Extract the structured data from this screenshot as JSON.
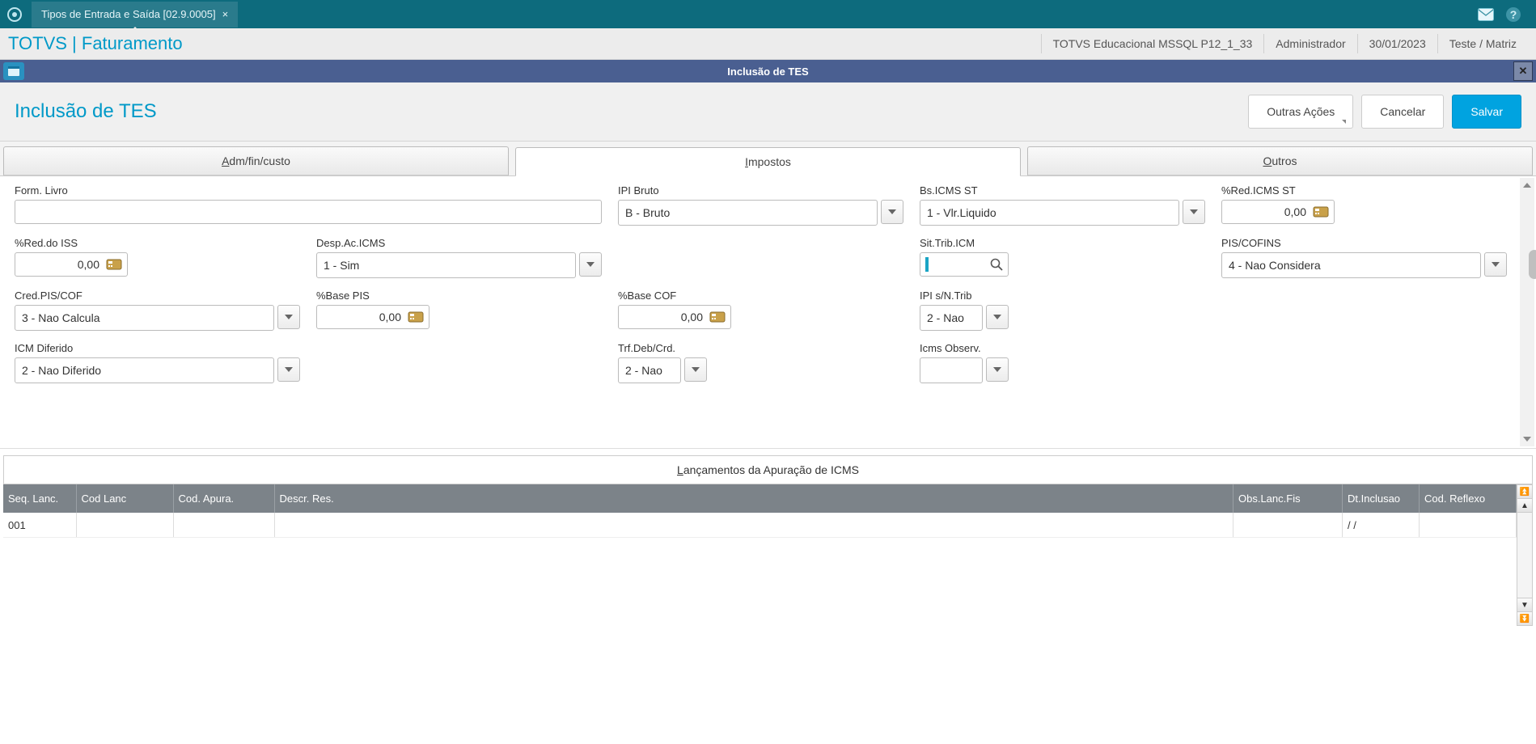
{
  "topbar": {
    "tab_title": "Tipos de Entrada e Saída [02.9.0005]"
  },
  "infobar": {
    "module": "TOTVS | Faturamento",
    "env": "TOTVS Educacional MSSQL P12_1_33",
    "user": "Administrador",
    "date": "30/01/2023",
    "branch": "Teste / Matriz"
  },
  "winbar": {
    "title": "Inclusão de TES"
  },
  "actionbar": {
    "page_title": "Inclusão de TES",
    "other_actions": "Outras Ações",
    "cancel": "Cancelar",
    "save": "Salvar"
  },
  "tabs": {
    "t1_pre": "A",
    "t1_rest": "dm/fin/custo",
    "t2_pre": "I",
    "t2_rest": "mpostos",
    "t3_pre": "O",
    "t3_rest": "utros"
  },
  "fields": {
    "form_livro": {
      "label": "Form. Livro",
      "value": ""
    },
    "ipi_bruto": {
      "label": "IPI Bruto",
      "value": "B - Bruto"
    },
    "bs_icms_st": {
      "label": "Bs.ICMS ST",
      "value": "1 - Vlr.Liquido"
    },
    "pred_icms_st": {
      "label": "%Red.ICMS ST",
      "value": "0,00"
    },
    "pred_iss": {
      "label": "%Red.do ISS",
      "value": "0,00"
    },
    "desp_ac_icms": {
      "label": "Desp.Ac.ICMS",
      "value": "1 - Sim"
    },
    "sit_trib_icm": {
      "label": "Sit.Trib.ICM",
      "value": ""
    },
    "pis_cofins": {
      "label": "PIS/COFINS",
      "value": "4 - Nao Considera"
    },
    "cred_pis_cof": {
      "label": "Cred.PIS/COF",
      "value": "3 - Nao Calcula"
    },
    "pbase_pis": {
      "label": "%Base PIS",
      "value": "0,00"
    },
    "pbase_cof": {
      "label": "%Base COF",
      "value": "0,00"
    },
    "ipi_sntrib": {
      "label": "IPI s/N.Trib",
      "value": "2 - Nao"
    },
    "icm_diferido": {
      "label": "ICM Diferido",
      "value": "2 - Nao Diferido"
    },
    "trf_deb_crd": {
      "label": "Trf.Deb/Crd.",
      "value": "2 - Nao"
    },
    "icms_observ": {
      "label": "Icms Observ.",
      "value": ""
    }
  },
  "grid": {
    "title_pre": "L",
    "title_rest": "ançamentos da Apuração de ICMS",
    "headers": {
      "seq": "Seq. Lanc.",
      "cod_lanc": "Cod Lanc",
      "cod_apura": "Cod. Apura.",
      "descr": "Descr. Res.",
      "obs": "Obs.Lanc.Fis",
      "dt": "Dt.Inclusao",
      "reflexo": "Cod. Reflexo"
    },
    "rows": [
      {
        "seq": "001",
        "cod_lanc": "",
        "cod_apura": "",
        "descr": "",
        "obs": "",
        "dt": "  /  /",
        "reflexo": ""
      }
    ]
  }
}
